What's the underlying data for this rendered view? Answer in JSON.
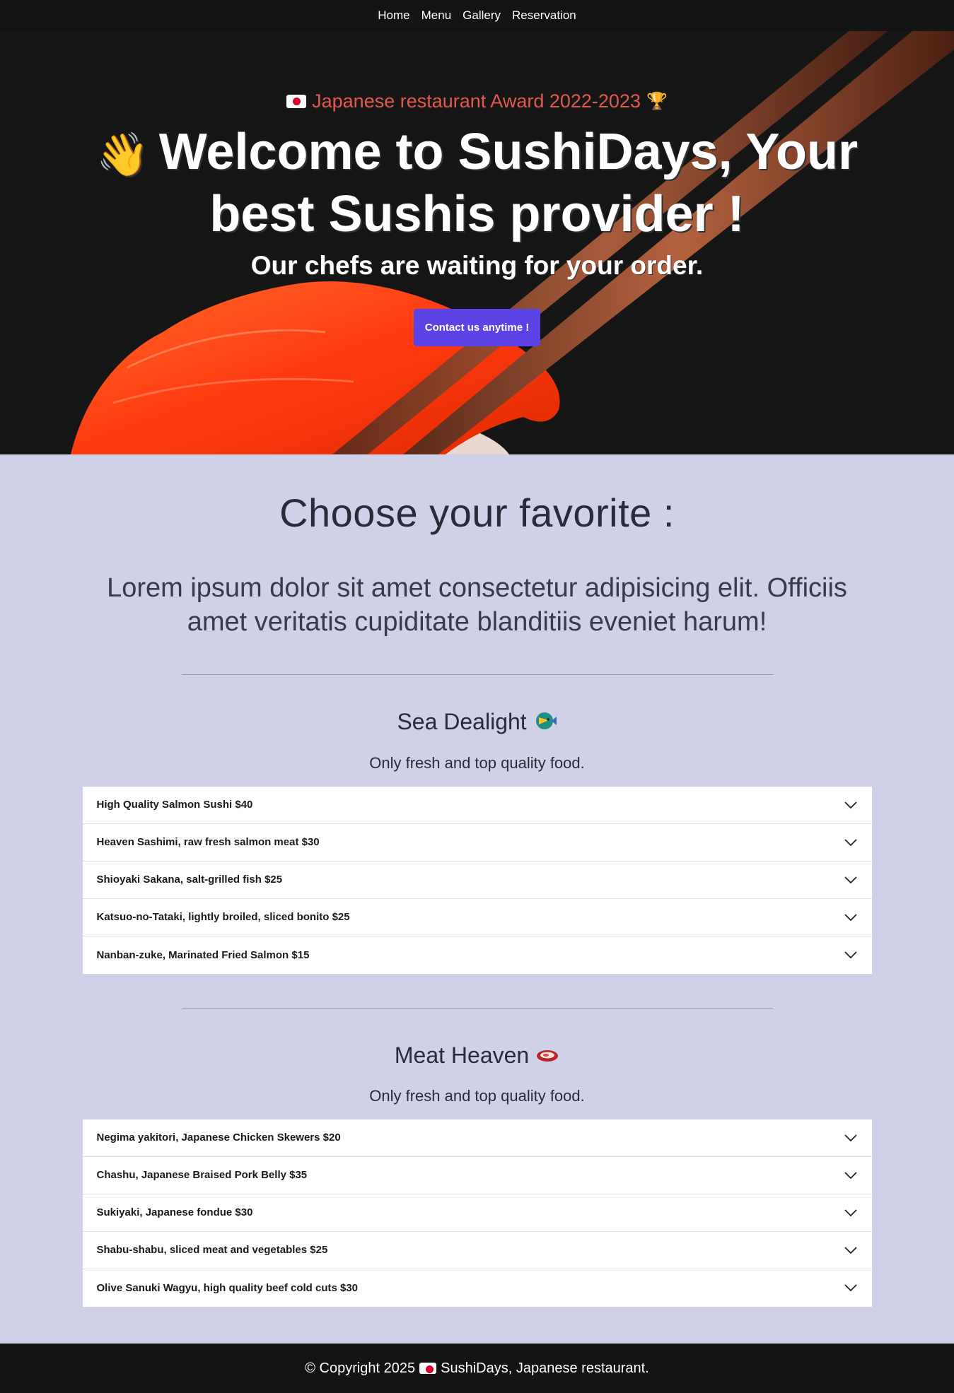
{
  "nav": {
    "items": [
      "Home",
      "Menu",
      "Gallery",
      "Reservation"
    ]
  },
  "hero": {
    "award": "Japanese restaurant Award 2022-2023",
    "headline_line1": "Welcome to SushiDays, Your",
    "headline_line2": "best Sushis provider !",
    "subhead": "Our chefs are waiting for your order.",
    "cta_label": "Contact us anytime !"
  },
  "main": {
    "title": "Choose your favorite :",
    "lead": "Lorem ipsum dolor sit amet consectetur adipisicing elit. Officiis amet veritatis cupiditate blanditiis eveniet harum!"
  },
  "sections": [
    {
      "title": "Sea Dealight",
      "icon": "fish-icon",
      "subtitle": "Only fresh and top quality food.",
      "items": [
        "High Quality Salmon Sushi $40",
        "Heaven Sashimi, raw fresh salmon meat $30",
        "Shioyaki Sakana, salt-grilled fish $25",
        "Katsuo-no-Tataki, lightly broiled, sliced bonito $25",
        "Nanban-zuke, Marinated Fried Salmon $15"
      ]
    },
    {
      "title": "Meat Heaven",
      "icon": "meat-icon",
      "subtitle": "Only fresh and top quality food.",
      "items": [
        "Negima yakitori, Japanese Chicken Skewers $20",
        "Chashu, Japanese Braised Pork Belly $35",
        "Sukiyaki, Japanese fondue $30",
        "Shabu-shabu, sliced meat and vegetables $25",
        "Olive Sanuki Wagyu, high quality beef cold cuts $30"
      ]
    }
  ],
  "footer": {
    "copyright": "© Copyright 2025",
    "name": "SushiDays, Japanese restaurant."
  },
  "colors": {
    "accent": "#5b43e6",
    "award": "#e05a4f",
    "page_bg": "#d0d0e8",
    "dark": "#141414"
  }
}
